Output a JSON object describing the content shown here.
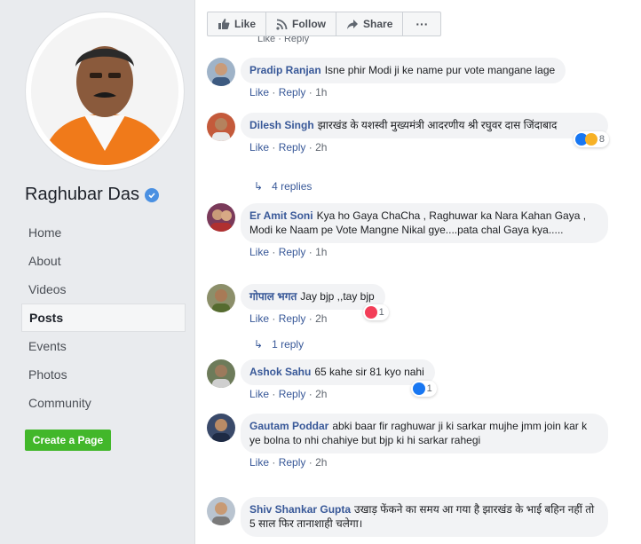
{
  "sidebar": {
    "page_name": "Raghubar Das",
    "nav": [
      "Home",
      "About",
      "Videos",
      "Posts",
      "Events",
      "Photos",
      "Community"
    ],
    "active_nav": "Posts",
    "create_page": "Create a Page"
  },
  "actions": {
    "like": "Like",
    "follow": "Follow",
    "share": "Share",
    "more": "···"
  },
  "meta_labels": {
    "like": "Like",
    "reply": "Reply",
    "sep": "·"
  },
  "comments": [
    {
      "author": "Pradip Ranjan",
      "text": "Isne phir Modi ji ke name pur vote mangane lage",
      "time": "1h"
    },
    {
      "author": "Dilesh Singh",
      "text": "झारखंड के यशस्वी मुख्यमंत्री आदरणीय श्री रघुवर दास जिंदाबाद",
      "time": "2h",
      "reaction_count": "8"
    },
    {
      "author": "Er Amit Soni",
      "text": "Kya ho Gaya ChaCha , Raghuwar ka Nara Kahan Gaya , Modi ke Naam pe Vote Mangne Nikal gye....pata chal Gaya kya.....",
      "time": "1h"
    },
    {
      "author": "गोपाल भगत",
      "text": "Jay bjp ,,tay bjp",
      "time": "2h",
      "reaction_count": "1"
    },
    {
      "author": "Ashok Sahu",
      "text": "65 kahe sir 81 kyo nahi",
      "time": "2h",
      "reaction_count": "1"
    },
    {
      "author": "Gautam Poddar",
      "text": "abki baar fir raghuwar ji ki sarkar mujhe jmm join kar k ye bolna to nhi chahiye but bjp ki hi sarkar rahegi",
      "time": "2h"
    },
    {
      "author": "Shiv Shankar Gupta",
      "text": "उखाड़ फेंकने का समय आ गया है झारखंड के भाई बहिन नहीं तो 5 साल फिर तानाशाही चलेगा।",
      "time": ""
    }
  ],
  "replies": [
    "4 replies",
    "1 reply"
  ],
  "colors": {
    "link": "#385898",
    "green": "#42b72a",
    "like_blue": "#1877f2",
    "love_red": "#f33e58"
  }
}
